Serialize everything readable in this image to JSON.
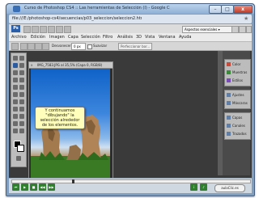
{
  "window": {
    "title": "Curso de Photoshop CS4 :: Las herramientas de Selección (I) - Google Chrome",
    "min_label": "–",
    "max_label": "□",
    "close_label": "x"
  },
  "browser": {
    "url": "file:///E:/photoshop-cs4/secuencias/p03_seleccion/seleccion2.htm",
    "star_icon": "★"
  },
  "photoshop": {
    "logo": "Ps",
    "workspace": "Aspectos esenciales ▾",
    "menus": [
      "Archivo",
      "Edición",
      "Imagen",
      "Capa",
      "Selección",
      "Filtro",
      "Análisis",
      "3D",
      "Vista",
      "Ventana",
      "Ayuda"
    ],
    "options": {
      "feather_label": "Desvanecer:",
      "feather_value": "0 px",
      "antialias_label": "Suavizar",
      "refine_button": "Perfeccionar bor..."
    },
    "document": {
      "title": "IMG_7583.JPG al 35,5% (Capa 0, RGB/8)",
      "close_label": "x",
      "zoom": "35,5%",
      "tooltip": "Y continuamos \"dibujando\" la selección alrededor de los elementos."
    },
    "panels": [
      {
        "name": "Color",
        "icon": "color-icon"
      },
      {
        "name": "Muestras",
        "icon": "swatches-icon"
      },
      {
        "name": "Estilos",
        "icon": "styles-icon"
      },
      {
        "name": "Ajustes",
        "icon": "adjustments-icon"
      },
      {
        "name": "Máscaras",
        "icon": "masks-icon"
      },
      {
        "name": "Capas",
        "icon": "layers-icon"
      },
      {
        "name": "Canales",
        "icon": "channels-icon"
      },
      {
        "name": "Trazados",
        "icon": "paths-icon"
      }
    ]
  },
  "player": {
    "badge": "aulaClic.es"
  }
}
